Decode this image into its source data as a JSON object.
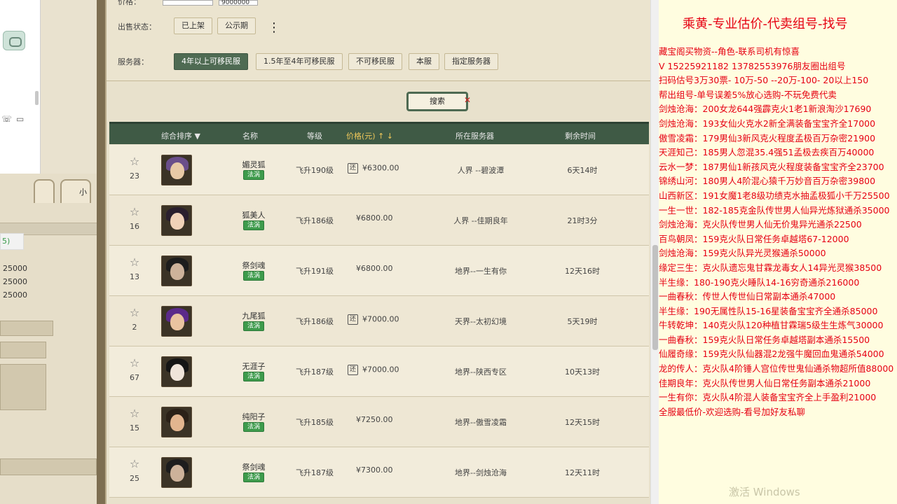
{
  "left": {
    "badge": "5)",
    "amounts": [
      "25000",
      "25000",
      "25000"
    ],
    "tab_label": "小"
  },
  "filter": {
    "price_label": "价格：",
    "price_max": "9000000",
    "sale_status_label": "出售状态：",
    "sale_status_options": [
      "已上架",
      "公示期"
    ],
    "more_icon": "⋮",
    "server_label": "服务器：",
    "server_options": [
      "4年以上可移民服",
      "1.5年至4年可移民服",
      "不可移民服",
      "本服",
      "指定服务器"
    ],
    "server_selected": "4年以上可移民服"
  },
  "search": {
    "label": "搜索",
    "clear": "✕"
  },
  "table": {
    "headers": {
      "sort": "综合排序 ▼",
      "name": "名称",
      "level": "等级",
      "price": "价格(元) ↑ ↓",
      "server": "所在服务器",
      "remain": "剩余时间"
    },
    "rows": [
      {
        "fav": "23",
        "name": "媚灵狐",
        "badge": "法涡",
        "level": "飞升190级",
        "haggle": true,
        "price": "¥6300.00",
        "server": "人界 --碧波潭",
        "remain": "6天14时",
        "skin": "#e8c9a6",
        "hair": "#6a4e8a"
      },
      {
        "fav": "16",
        "name": "狐美人",
        "badge": "法涡",
        "level": "飞升186级",
        "haggle": false,
        "price": "¥6800.00",
        "server": "人界 --佳期良年",
        "remain": "21时3分",
        "skin": "#f0d2b8",
        "hair": "#2a1f2e"
      },
      {
        "fav": "13",
        "name": "祭剑魂",
        "badge": "法涡",
        "level": "飞升191级",
        "haggle": false,
        "price": "¥6800.00",
        "server": "地界--一生有你",
        "remain": "12天16时",
        "skin": "#cdb29a",
        "hair": "#1d1d1d"
      },
      {
        "fav": "2",
        "name": "九尾狐",
        "badge": "法涡",
        "level": "飞升186级",
        "haggle": true,
        "price": "¥7000.00",
        "server": "天界--太初幻境",
        "remain": "5天19时",
        "skin": "#e9c3a0",
        "hair": "#5b2a8a"
      },
      {
        "fav": "67",
        "name": "无涯子",
        "badge": "法涡",
        "level": "飞升187级",
        "haggle": true,
        "price": "¥7000.00",
        "server": "地界--陕西专区",
        "remain": "10天13时",
        "skin": "#efe4da",
        "hair": "#151515"
      },
      {
        "fav": "15",
        "name": "纯阳子",
        "badge": "法涡",
        "level": "飞升185级",
        "haggle": false,
        "price": "¥7250.00",
        "server": "地界--傲雪凌霜",
        "remain": "12天15时",
        "skin": "#e2b58f",
        "hair": "#2b2118"
      },
      {
        "fav": "25",
        "name": "祭剑魂",
        "badge": "法涡",
        "level": "飞升187级",
        "haggle": false,
        "price": "¥7300.00",
        "server": "地界--剑烛沧海",
        "remain": "12天11时",
        "skin": "#cdb29a",
        "hair": "#1d1d1d"
      }
    ]
  },
  "notes": {
    "title": "乘黄-专业估价-代卖组号-找号",
    "lines": [
      "藏宝阁买物资--角色-联系司机有惊喜",
      "V 15225921182  13782553976朋友圈出组号",
      "扫码估号3万30票- 10万-50 --20万-100- 20以上150",
      "帮出组号-单号误差5%放心选购-不玩免费代卖",
      "剑烛沧海：200女龙644强霹克火1老1新浪淘沙17690",
      "剑烛沧海：193女仙火克水2新全满装备宝宝齐全17000",
      "傲雪凌霜：179男仙3新风克火程度孟极百万杂密21900",
      "天涯知己：185男人忽混35.4强51孟极去疾百万40000",
      "云水一梦：187男仙1新孩风克火程度装备宝宝齐全23700",
      "锦绣山河：180男人4阶混心猿千万妙音百万杂密39800",
      "山西新区：191女魔1老8级功绩克水抽孟极狐小千万25500",
      "一生一世：182-185克金队传世男人仙异光炼狱通杀35000",
      "剑烛沧海：克火队传世男人仙无价鬼异光通杀22500",
      "百鸟朝凤：159克火队日常任务卓越塔67-12000",
      "剑烛沧海：159克火队异光灵猴通杀50000",
      "缘定三生：克火队遗忘鬼甘霖龙毒女人14异光灵猴38500",
      "半生缘：180-190克火睡队14-16穷奇通杀216000",
      "一曲春秋：传世人传世仙日常副本通杀47000",
      "半生缘：190无属性队15-16星装备宝宝齐全通杀85000",
      "牛转乾坤：140克火队120种植甘霖瑞5级生生炼气30000",
      "一曲春秋：159克火队日常任务卓越塔副本通杀15500",
      "仙履奇缘：159克火队仙器混2龙强牛魔回血鬼通杀54000",
      "龙的传人：克火队4阶锤人宫位传世鬼仙通杀物超所值88000",
      "佳期良年：克火队传世男人仙日常任务副本通杀21000",
      "一生有你：克火队4阶混人装备宝宝齐全上手盈利21000",
      "全服最低价-欢迎选购-看号加好友私聊"
    ],
    "watermark": "激活 Windows"
  }
}
